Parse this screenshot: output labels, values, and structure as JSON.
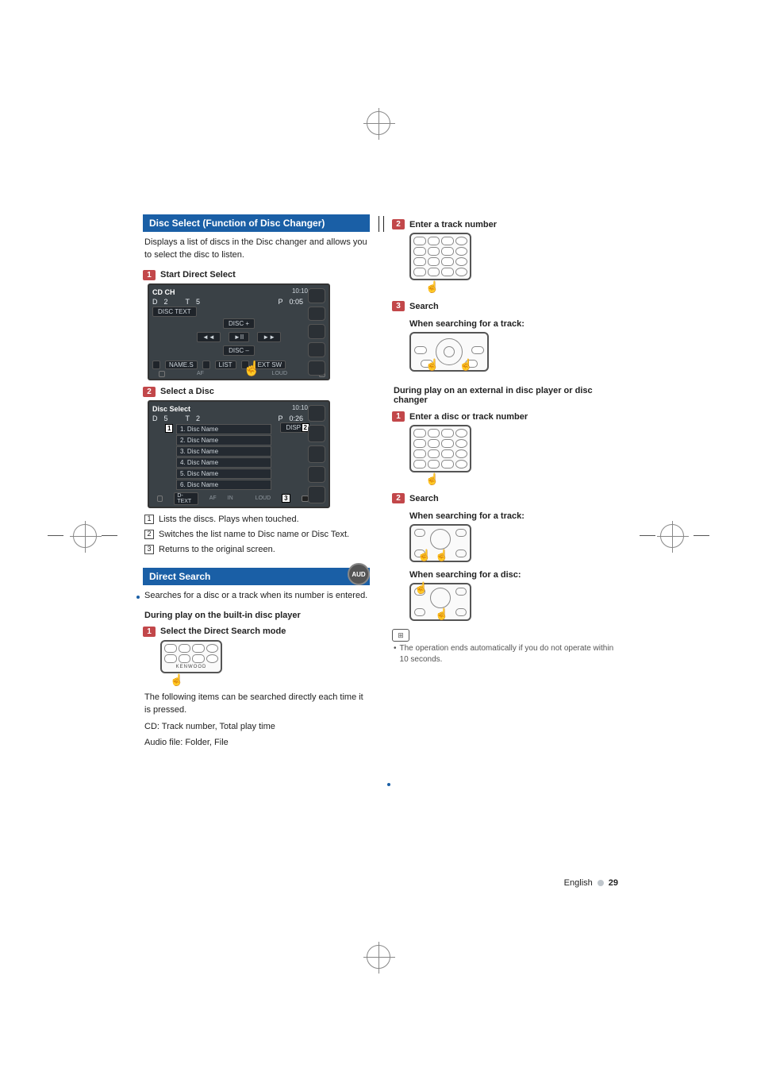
{
  "left": {
    "discSelect": {
      "title": "Disc Select (Function of Disc Changer)",
      "desc": "Displays a list of discs in the Disc changer and allows you to select the disc to listen.",
      "step1": {
        "num": "1",
        "label": "Start Direct Select"
      },
      "screen1": {
        "header": "CD CH",
        "d_label": "D",
        "d_val": "2",
        "t_label": "T",
        "t_val": "5",
        "p_label": "P",
        "p_val": "0:05",
        "clock": "10:10",
        "disctext": "DISC TEXT",
        "disc_plus": "DISC +",
        "disc_minus": "DISC –",
        "prev": "◄◄",
        "play": "►II",
        "next": "►►",
        "name_s": "NAME.S",
        "list": "LIST",
        "ext_sw": "EXT SW",
        "af": "AF",
        "loud": "LOUD"
      },
      "step2": {
        "num": "2",
        "label": "Select a Disc"
      },
      "screen2": {
        "header": "Disc Select",
        "d_label": "D",
        "d_val": "5",
        "t_label": "T",
        "t_val": "2",
        "p_label": "P",
        "p_val": "0:26",
        "clock": "10:10",
        "items": [
          "1. Disc Name",
          "2. Disc Name",
          "3. Disc Name",
          "4. Disc Name",
          "5. Disc Name",
          "6. Disc Name"
        ],
        "dtext": "D-TEXT",
        "disp": "DISP",
        "af": "AF",
        "in": "IN",
        "loud": "LOUD",
        "tag1": "1",
        "tag2": "2",
        "tag3": "3"
      },
      "annotations": [
        {
          "n": "1",
          "text": "Lists the discs. Plays when touched."
        },
        {
          "n": "2",
          "text": "Switches the list name to Disc name or Disc Text."
        },
        {
          "n": "3",
          "text": "Returns to the original screen."
        }
      ]
    },
    "directSearch": {
      "title": "Direct Search",
      "badge": "AUD",
      "desc": "Searches for a disc or a track when its number is entered.",
      "sub1": "During play on the built-in disc player",
      "step1": {
        "num": "1",
        "label": "Select the Direct Search mode"
      },
      "remote_brand": "KENWOOD",
      "note": "The following items can be searched directly each time it is pressed.",
      "note_cd": "CD: Track number, Total play time",
      "note_audio": "Audio file: Folder, File"
    }
  },
  "right": {
    "step2": {
      "num": "2",
      "label": "Enter a track number"
    },
    "step3": {
      "num": "3",
      "label": "Search"
    },
    "when_track": "When searching for a track:",
    "ext_heading": "During play on an external in disc player or disc changer",
    "ext_step1": {
      "num": "1",
      "label": "Enter a disc or track number"
    },
    "ext_step2": {
      "num": "2",
      "label": "Search"
    },
    "when_track2": "When searching for a track:",
    "when_disc": "When searching for a disc:",
    "note": "The operation ends automatically if you do not operate within 10 seconds."
  },
  "footer": {
    "lang": "English",
    "page": "29"
  }
}
